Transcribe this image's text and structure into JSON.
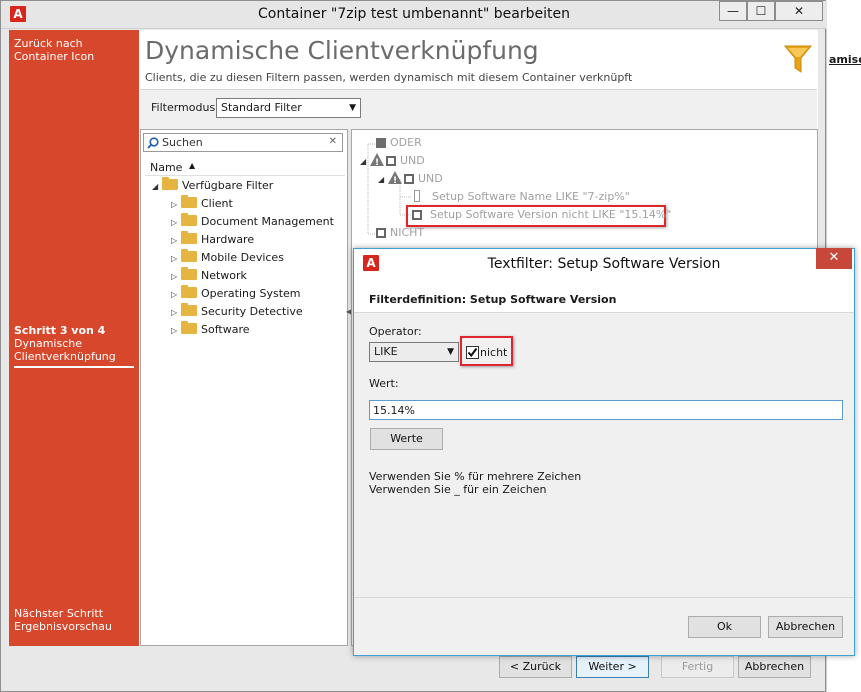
{
  "colors": {
    "sidebar": "#d7472b",
    "accent_red": "#e0252b",
    "dialog_border": "#3fa0d6",
    "filter_icon": "#e8a317"
  },
  "main_window": {
    "title": "Container \"7zip test umbenannt\" bearbeiten",
    "controls": {
      "minimize": "—",
      "maximize": "☐",
      "close": "✕"
    }
  },
  "background_window": {
    "text": "amische"
  },
  "sidebar": {
    "back_line1": "Zurück nach",
    "back_line2": "Container Icon",
    "step_label": "Schritt 3 von 4",
    "step_name_line1": "Dynamische",
    "step_name_line2": "Clientverknüpfung",
    "next_label": "Nächster Schritt",
    "next_name": "Ergebnisvorschau"
  },
  "page": {
    "title": "Dynamische Clientverknüpfung",
    "subtitle": "Clients, die zu diesen Filtern passen, werden dynamisch mit diesem Container verknüpft",
    "filter_icon": "funnel-icon"
  },
  "filtermode": {
    "label": "Filtermodus:",
    "value": "Standard Filter"
  },
  "search": {
    "placeholder": "Suchen",
    "clear": "✕"
  },
  "left_tree": {
    "column_header": "Name",
    "root": "Verfügbare Filter",
    "items": [
      "Client",
      "Document Management",
      "Hardware",
      "Mobile Devices",
      "Network",
      "Operating System",
      "Security Detective",
      "Software"
    ]
  },
  "filter_tree": {
    "oder": "ODER",
    "und1": "UND",
    "und2": "UND",
    "leaf1": "Setup Software Name LIKE  \"7-zip%\"",
    "leaf2": "Setup Software Version nicht LIKE  \"15.14%\"",
    "nicht": "NICHT"
  },
  "footer": {
    "back": "< Zurück",
    "next": "Weiter >",
    "finish": "Fertig",
    "cancel": "Abbrechen"
  },
  "dialog": {
    "title": "Textfilter: Setup Software Version",
    "close": "✕",
    "heading": "Filterdefinition: Setup Software Version",
    "operator_label": "Operator:",
    "operator_value": "LIKE",
    "not_checkbox_label": "nicht",
    "not_checked": true,
    "value_label": "Wert:",
    "value": "15.14%",
    "values_button": "Werte",
    "hint_line1": "Verwenden Sie % für mehrere Zeichen",
    "hint_line2": "Verwenden Sie _ für ein Zeichen",
    "ok": "Ok",
    "cancel": "Abbrechen"
  }
}
